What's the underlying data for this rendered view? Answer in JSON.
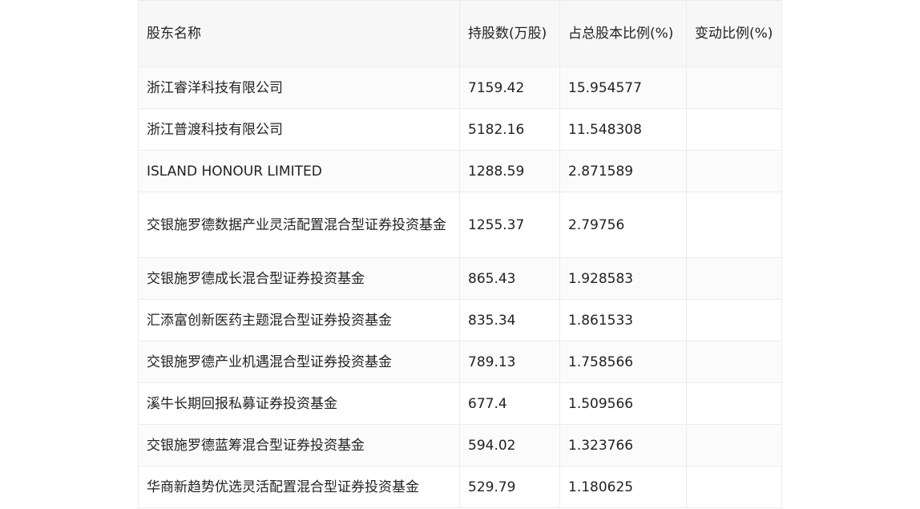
{
  "table": {
    "headers": [
      "股东名称",
      "持股数(万股)",
      "占总股本比例(%)",
      "变动比例(%)"
    ],
    "rows": [
      {
        "name": "浙江睿洋科技有限公司",
        "shares": "7159.42",
        "ratio": "15.954577",
        "change": ""
      },
      {
        "name": "浙江普渡科技有限公司",
        "shares": "5182.16",
        "ratio": "11.548308",
        "change": ""
      },
      {
        "name": "ISLAND HONOUR LIMITED",
        "shares": "1288.59",
        "ratio": "2.871589",
        "change": ""
      },
      {
        "name": "交银施罗德数据产业灵活配置混合型证券投资基金",
        "shares": "1255.37",
        "ratio": "2.79756",
        "change": ""
      },
      {
        "name": "交银施罗德成长混合型证券投资基金",
        "shares": "865.43",
        "ratio": "1.928583",
        "change": ""
      },
      {
        "name": "汇添富创新医药主题混合型证券投资基金",
        "shares": "835.34",
        "ratio": "1.861533",
        "change": ""
      },
      {
        "name": "交银施罗德产业机遇混合型证券投资基金",
        "shares": "789.13",
        "ratio": "1.758566",
        "change": ""
      },
      {
        "name": "溪牛长期回报私募证券投资基金",
        "shares": "677.4",
        "ratio": "1.509566",
        "change": ""
      },
      {
        "name": "交银施罗德蓝筹混合型证券投资基金",
        "shares": "594.02",
        "ratio": "1.323766",
        "change": ""
      },
      {
        "name": "华商新趋势优选灵活配置混合型证券投资基金",
        "shares": "529.79",
        "ratio": "1.180625",
        "change": ""
      }
    ]
  }
}
